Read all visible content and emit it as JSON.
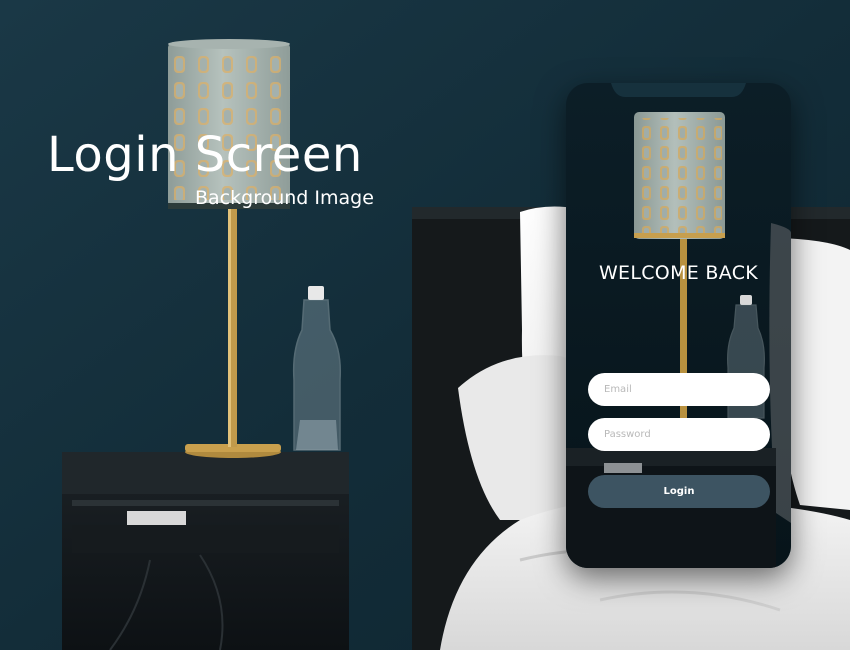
{
  "title": {
    "main": "Login Screen",
    "sub": "Background Image"
  },
  "phone": {
    "welcome": "WELCOME BACK",
    "email_placeholder": "Email",
    "password_placeholder": "Password",
    "login_label": "Login"
  },
  "colors": {
    "wall": "#14303c",
    "button": "#3d5462",
    "field": "#ffffff",
    "text": "#ffffff"
  }
}
